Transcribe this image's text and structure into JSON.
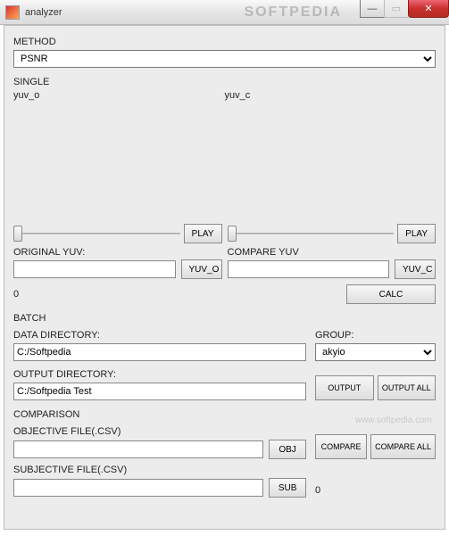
{
  "window": {
    "title": "analyzer",
    "ghost_brand": "SOFTPEDIA"
  },
  "method": {
    "label": "METHOD",
    "value": "PSNR"
  },
  "single": {
    "label": "SINGLE",
    "yuv_o_label": "yuv_o",
    "yuv_c_label": "yuv_c",
    "play_label": "PLAY",
    "original_label": "ORIGINAL YUV:",
    "compare_label": "COMPARE YUV",
    "yuv_o_btn": "YUV_O",
    "yuv_c_btn": "YUV_C",
    "original_value": "",
    "compare_value": "",
    "result_value": "0",
    "calc_label": "CALC"
  },
  "batch": {
    "label": "BATCH",
    "data_dir_label": "DATA DIRECTORY:",
    "data_dir_value": "C:/Softpedia",
    "group_label": "GROUP:",
    "group_value": "akyio",
    "output_dir_label": "OUTPUT DIRECTORY:",
    "output_dir_value": "C:/Softpedia Test",
    "output_btn": "OUTPUT",
    "output_all_btn": "OUTPUT ALL"
  },
  "comparison": {
    "label": "COMPARISON",
    "obj_label": "OBJECTIVE FILE(.CSV)",
    "obj_value": "",
    "obj_btn": "OBJ",
    "subj_label": "SUBJECTIVE FILE(.CSV)",
    "subj_value": "",
    "sub_btn": "SUB",
    "compare_btn": "COMPARE",
    "compare_all_btn": "COMPARE ALL",
    "result_value": "0"
  },
  "watermark": "www.softpedia.com"
}
